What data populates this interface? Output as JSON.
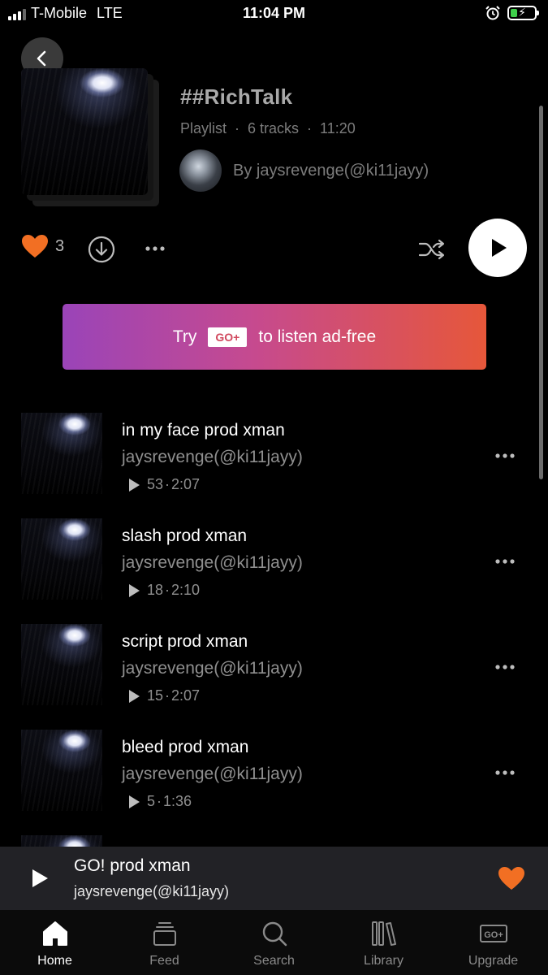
{
  "status_bar": {
    "carrier": "T-Mobile",
    "network": "LTE",
    "time": "11:04 PM",
    "battery_level": 0.3
  },
  "playlist": {
    "title": "##RichTalk",
    "type": "Playlist",
    "tracks_count": "6 tracks",
    "duration": "11:20",
    "owner_prefix": "By",
    "owner": "jaysrevenge(@ki11jayy)",
    "likes": "3"
  },
  "promo": {
    "try": "Try",
    "badge": "GO+",
    "text": "to listen ad-free"
  },
  "tracks": [
    {
      "title": "in my face prod xman",
      "artist": "jaysrevenge(@ki11jayy)",
      "plays": "53",
      "duration": "2:07"
    },
    {
      "title": "slash prod xman",
      "artist": "jaysrevenge(@ki11jayy)",
      "plays": "18",
      "duration": "2:10"
    },
    {
      "title": "script prod xman",
      "artist": "jaysrevenge(@ki11jayy)",
      "plays": "15",
      "duration": "2:07"
    },
    {
      "title": "bleed prod xman",
      "artist": "jaysrevenge(@ki11jayy)",
      "plays": "5",
      "duration": "1:36"
    }
  ],
  "now_playing": {
    "title": "GO! prod xman",
    "artist": "jaysrevenge(@ki11jayy)"
  },
  "tabs": [
    {
      "label": "Home",
      "icon": "home-icon",
      "active": true
    },
    {
      "label": "Feed",
      "icon": "feed-icon"
    },
    {
      "label": "Search",
      "icon": "search-icon"
    },
    {
      "label": "Library",
      "icon": "library-icon"
    },
    {
      "label": "Upgrade",
      "icon": "go-plus-icon"
    }
  ],
  "colors": {
    "accent": "#f26f23",
    "background": "#000000",
    "promo_start": "#9a44b8",
    "promo_end": "#e6573a"
  }
}
